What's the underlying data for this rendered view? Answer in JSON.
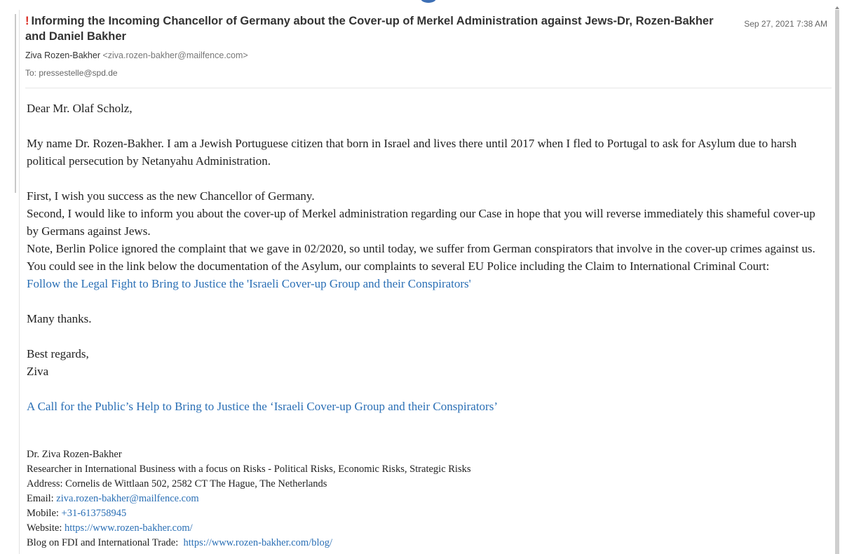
{
  "email": {
    "important_mark": "!",
    "subject": "Informing the Incoming Chancellor of Germany about the Cover-up of Merkel Administration against Jews-Dr, Rozen-Bakher and Daniel Bakher",
    "date": "Sep 27, 2021 7:38 AM",
    "from_name": "Ziva Rozen-Bakher",
    "from_email": "<ziva.rozen-bakher@mailfence.com>",
    "to": "To: pressestelle@spd.de"
  },
  "body": {
    "greeting": "Dear Mr. Olaf Scholz,",
    "para1": "My name Dr. Rozen-Bakher. I am a Jewish Portuguese citizen that born in Israel and lives there until 2017 when I fled to Portugal to ask for Asylum due to harsh political persecution by Netanyahu Administration.",
    "line_first": "First, I wish you success as the new Chancellor of Germany.",
    "line_second": "Second, I would like to inform you about the cover-up of Merkel administration regarding our Case in hope that you will reverse immediately this shameful cover-up by Germans against Jews.",
    "line_note": "Note, Berlin Police ignored the complaint that we gave in 02/2020, so until today, we suffer from German conspirators that involve in the cover-up crimes against us.",
    "line_link_intro": "You could see in the link below the documentation of the Asylum, our complaints to several EU Police including the Claim to International Criminal Court:",
    "link1": "Follow the Legal Fight to Bring to Justice the 'Israeli Cover-up Group and their Conspirators'",
    "thanks": "Many thanks.",
    "regards": "Best regards,",
    "name": "Ziva",
    "link2": "A Call for the Public’s Help to Bring to Justice the ‘Israeli Cover-up Group and their Conspirators’"
  },
  "signature": {
    "name": "Dr. Ziva Rozen-Bakher",
    "title": "Researcher in International Business with a focus on Risks - Political Risks, Economic Risks, Strategic Risks",
    "address": "Address: Cornelis de Wittlaan 502, 2582 CT The Hague, The Netherlands",
    "email_label": "Email: ",
    "email": "ziva.rozen-bakher@mailfence.com",
    "mobile_label": "Mobile: ",
    "mobile": "+31-613758945",
    "website_label": "Website: ",
    "website": "https://www.rozen-bakher.com/",
    "blog_label": "Blog on FDI and International Trade:  ",
    "blog": "https://www.rozen-bakher.com/blog/"
  }
}
